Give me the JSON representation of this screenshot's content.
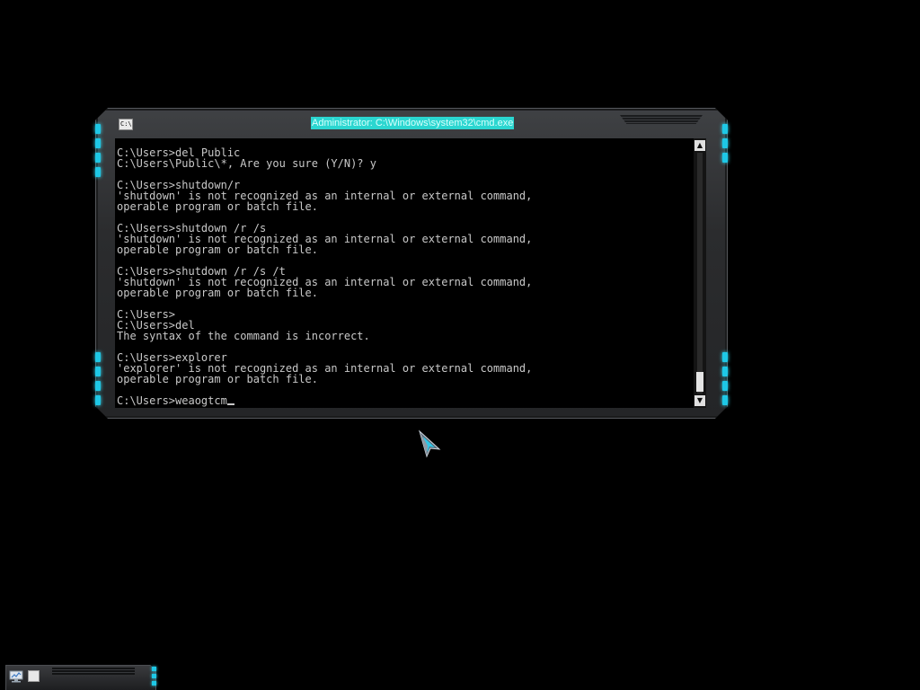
{
  "window": {
    "title": "Administrator: C:\\Windows\\system32\\cmd.exe",
    "icon": "console-icon"
  },
  "console": {
    "lines": [
      "",
      "C:\\Users>del Public",
      "C:\\Users\\Public\\*, Are you sure (Y/N)? y",
      "",
      "C:\\Users>shutdown/r",
      "'shutdown' is not recognized as an internal or external command,",
      "operable program or batch file.",
      "",
      "C:\\Users>shutdown /r /s",
      "'shutdown' is not recognized as an internal or external command,",
      "operable program or batch file.",
      "",
      "C:\\Users>shutdown /r /s /t",
      "'shutdown' is not recognized as an internal or external command,",
      "operable program or batch file.",
      "",
      "C:\\Users>",
      "C:\\Users>del",
      "The syntax of the command is incorrect.",
      "",
      "C:\\Users>explorer",
      "'explorer' is not recognized as an internal or external command,",
      "operable program or batch file.",
      ""
    ],
    "current_input": "C:\\Users>weaogtcm"
  },
  "scrollbar": {
    "up_glyph": "▲",
    "down_glyph": "▼",
    "position": 0.95
  },
  "taskbar": {
    "icons": [
      "monitor-icon",
      "window-icon"
    ]
  },
  "colors": {
    "accent": "#1ec8e6",
    "title_highlight": "#2bd6d0",
    "console_text": "#c8c8c8"
  }
}
